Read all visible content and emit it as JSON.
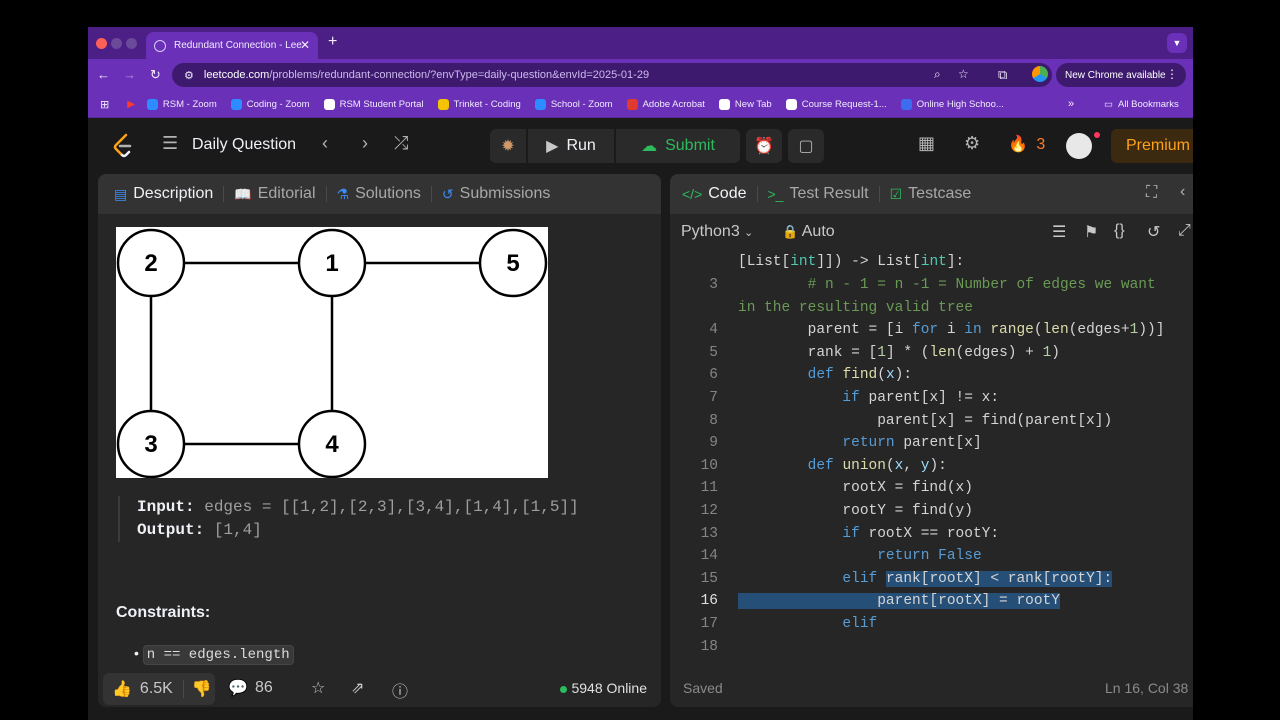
{
  "browser": {
    "tab_title": "Redundant Connection - Lee",
    "new_tab": "+",
    "url_host": "leetcode.com",
    "url_path": "/problems/redundant-connection/?envType=daily-question&envId=2025-01-29",
    "chrome_update": "New Chrome available",
    "bookmarks": [
      {
        "label": "RSM - Zoom",
        "color": "#2d8cff"
      },
      {
        "label": "Coding - Zoom",
        "color": "#2d8cff"
      },
      {
        "label": "RSM Student Portal",
        "color": "#ffffff"
      },
      {
        "label": "Trinket - Coding",
        "color": "#f5c400"
      },
      {
        "label": "School - Zoom",
        "color": "#2d8cff"
      },
      {
        "label": "Adobe Acrobat",
        "color": "#e03a2f"
      },
      {
        "label": "New Tab",
        "color": "#ffffff"
      },
      {
        "label": "Course Request-1...",
        "color": "#ffffff"
      },
      {
        "label": "Online High Schoo...",
        "color": "#3c6cf0"
      }
    ],
    "all_bookmarks": "All Bookmarks"
  },
  "nav": {
    "daily_question": "Daily Question",
    "run": "Run",
    "submit": "Submit",
    "streak": "3",
    "premium": "Premium"
  },
  "left": {
    "tabs": [
      "Description",
      "Editorial",
      "Solutions",
      "Submissions"
    ],
    "graph": {
      "nodes": [
        {
          "label": "2"
        },
        {
          "label": "1"
        },
        {
          "label": "5"
        },
        {
          "label": "3"
        },
        {
          "label": "4"
        }
      ]
    },
    "example": {
      "input_label": "Input:",
      "input_value": "edges = [[1,2],[2,3],[3,4],[1,4],[1,5]]",
      "output_label": "Output:",
      "output_value": "[1,4]"
    },
    "constraints_title": "Constraints:",
    "constraint_1": "n == edges.length",
    "likes": "6.5K",
    "comments": "86",
    "online": "5948 Online"
  },
  "right": {
    "tabs": [
      "Code",
      "Test Result",
      "Testcase"
    ],
    "language": "Python3",
    "mode": "Auto",
    "status": "Saved",
    "cursor": "Ln 16, Col 38",
    "line_numbers": [
      "3",
      "4",
      "5",
      "6",
      "7",
      "8",
      "9",
      "10",
      "11",
      "12",
      "13",
      "14",
      "15",
      "16",
      "17",
      "18"
    ]
  }
}
